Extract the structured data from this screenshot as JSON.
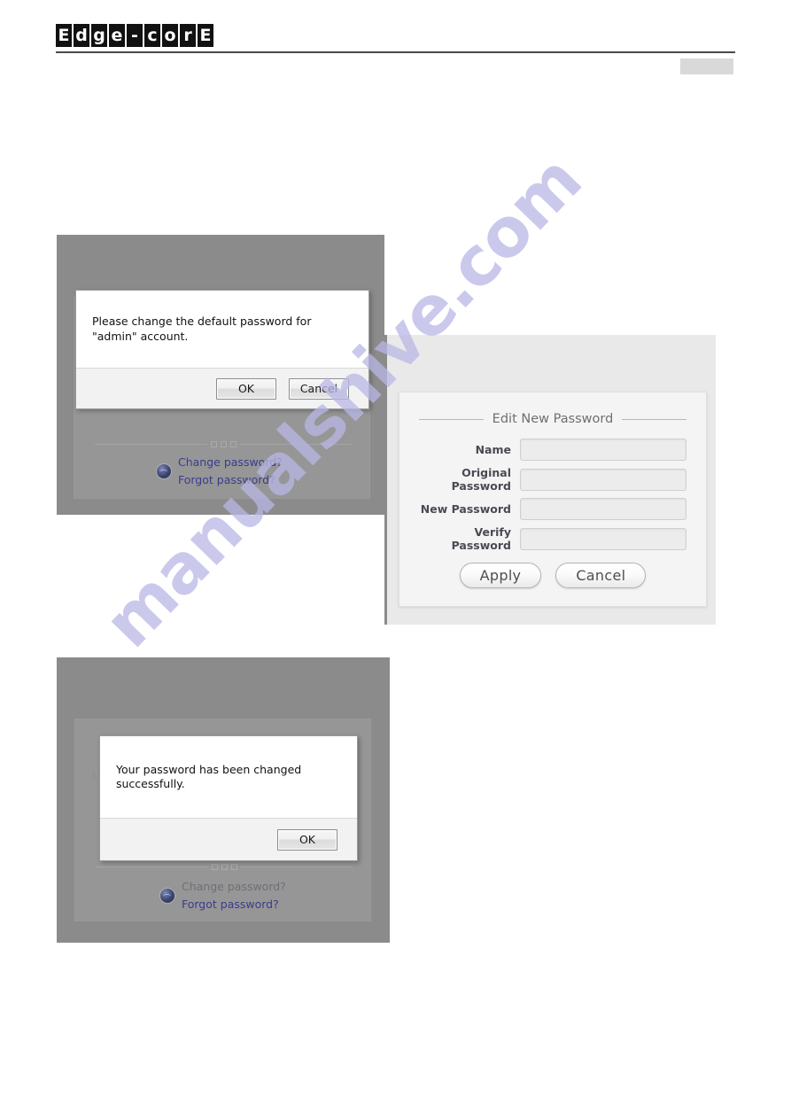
{
  "header": {
    "logo_letters": [
      "E",
      "d",
      "g",
      "e",
      "-",
      "c",
      "o",
      "r",
      "E"
    ]
  },
  "watermark": {
    "text": "manualshive.com"
  },
  "figure1": {
    "dialog": {
      "message": "Please change the default password for \"admin\" account.",
      "ok_label": "OK",
      "cancel_label": "Cancel"
    },
    "links": {
      "change": "Change password?",
      "forgot": "Forgot password?",
      "icon": "globe-icon"
    }
  },
  "figure2": {
    "panel_title": "Edit New Password",
    "fields": [
      {
        "label": "Name",
        "value": ""
      },
      {
        "label": "Original Password",
        "value": ""
      },
      {
        "label": "New Password",
        "value": ""
      },
      {
        "label": "Verify Password",
        "value": ""
      }
    ],
    "apply_label": "Apply",
    "cancel_label": "Cancel"
  },
  "figure3": {
    "dialog": {
      "message": "Your password has been changed successfully.",
      "ok_label": "OK"
    },
    "ghost_text": "U",
    "links": {
      "change": "Change password?",
      "forgot": "Forgot password?",
      "icon": "globe-icon"
    }
  },
  "colors": {
    "logo_bg": "#111111",
    "frame_gray": "#8b8b8b",
    "link_blue": "#3b3b8f",
    "watermark": "#b9b8e6"
  }
}
